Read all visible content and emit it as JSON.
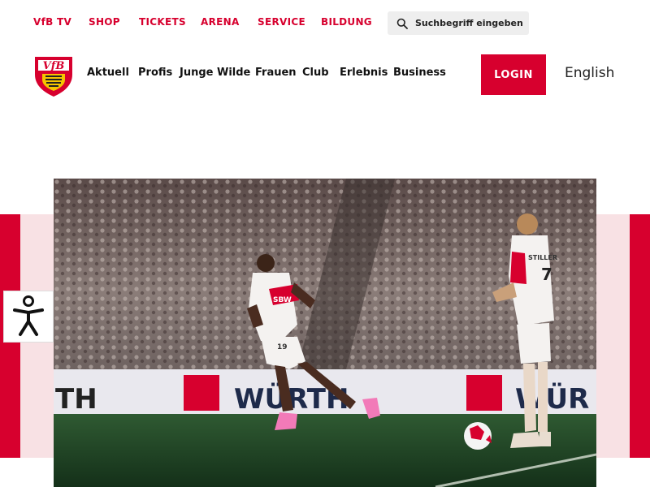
{
  "topnav": {
    "items": [
      "VfB TV",
      "SHOP",
      "TICKETS",
      "ARENA",
      "SERVICE",
      "BILDUNG"
    ],
    "search_placeholder": "Suchbegriff eingeben..."
  },
  "logo": {
    "text": "VfB",
    "alt": "VfB Stuttgart Logo"
  },
  "mainnav": {
    "items": [
      "Aktuell",
      "Profis",
      "Junge Wilde",
      "Frauen",
      "Club",
      "Erlebnis",
      "Business"
    ]
  },
  "header": {
    "login_label": "LOGIN",
    "language_label": "English"
  },
  "hero": {
    "board_text": "WÜRTH",
    "board_text_right": "WÜR",
    "board_text_left": "TH",
    "shirt_sponsor": "SBW",
    "player_right_name": "STILLER",
    "player_right_number": "7",
    "player_left_number": "19"
  },
  "colors": {
    "brand_red": "#d7002e",
    "pink": "#f8e1e4"
  },
  "accessibility": {
    "icon": "accessibility-person-icon"
  }
}
